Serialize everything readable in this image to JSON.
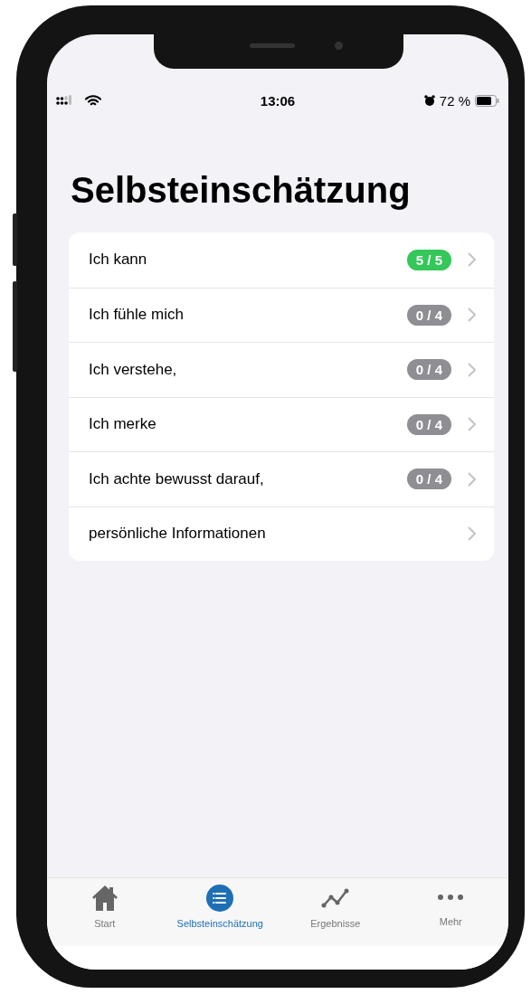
{
  "status_bar": {
    "time": "13:06",
    "battery": "72 %"
  },
  "title": "Selbsteinschätzung",
  "rows": [
    {
      "label": "Ich kann",
      "badge": "5 / 5",
      "color": "#34c759"
    },
    {
      "label": "Ich fühle mich",
      "badge": "0 / 4",
      "color": "#8e8e93"
    },
    {
      "label": "Ich verstehe,",
      "badge": "0 / 4",
      "color": "#8e8e93"
    },
    {
      "label": "Ich merke",
      "badge": "0 / 4",
      "color": "#8e8e93"
    },
    {
      "label": "Ich achte bewusst darauf,",
      "badge": "0 / 4",
      "color": "#8e8e93"
    },
    {
      "label": "persönliche Informationen"
    }
  ],
  "tabs": [
    {
      "label": "Start",
      "kind": "home",
      "selected": false
    },
    {
      "label": "Selbsteinschätzung",
      "kind": "list",
      "selected": true
    },
    {
      "label": "Ergebnisse",
      "kind": "chart",
      "selected": false
    },
    {
      "label": "Mehr",
      "kind": "more",
      "selected": false
    }
  ]
}
